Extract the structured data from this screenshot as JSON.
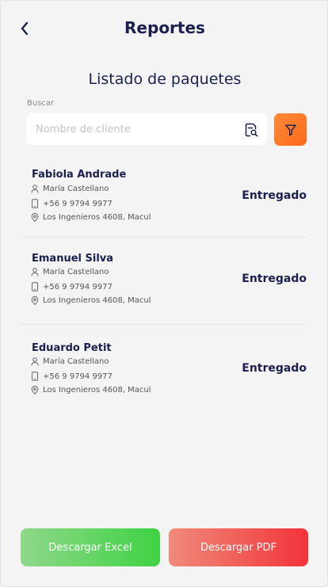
{
  "header": {
    "title": "Reportes",
    "back_icon": "chevron-left-icon"
  },
  "subtitle": "Listado de paquetes",
  "search": {
    "label": "Buscar",
    "placeholder": "Nombre de cliente",
    "value": "",
    "icon": "search-document-icon"
  },
  "filter": {
    "icon": "filter-icon",
    "color": "#ff7a2a"
  },
  "packages": [
    {
      "name": "Fabiola Andrade",
      "contact": "María Castellano",
      "phone": "+56 9 9794 9977",
      "address": "Los Ingenieros 4608, Macul",
      "status": "Entregado"
    },
    {
      "name": "Emanuel Silva",
      "contact": "María Castellano",
      "phone": "+56 9 9794 9977",
      "address": "Los Ingenieros 4608, Macul",
      "status": "Entregado"
    },
    {
      "name": "Eduardo Petit",
      "contact": "María Castellano",
      "phone": "+56 9 9794 9977",
      "address": "Los Ingenieros 4608, Macul",
      "status": "Entregado"
    }
  ],
  "actions": {
    "excel_label": "Descargar Excel",
    "pdf_label": "Descargar PDF"
  },
  "colors": {
    "primary_text": "#1a1f4d",
    "excel": "#3fd244",
    "pdf": "#f2343a"
  }
}
